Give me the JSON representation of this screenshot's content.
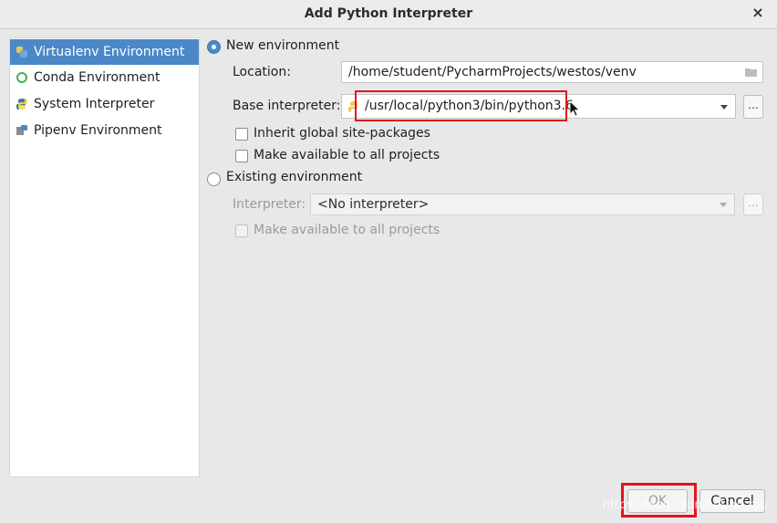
{
  "window": {
    "title": "Add Python Interpreter",
    "close_glyph": "×"
  },
  "sidebar": {
    "items": [
      {
        "label": "Virtualenv Environment",
        "icon": "virtualenv-icon",
        "selected": true
      },
      {
        "label": "Conda Environment",
        "icon": "conda-icon",
        "selected": false
      },
      {
        "label": "System Interpreter",
        "icon": "python-icon",
        "selected": false
      },
      {
        "label": "Pipenv Environment",
        "icon": "pipenv-icon",
        "selected": false
      }
    ]
  },
  "new_env": {
    "radio_label": "New environment",
    "selected": true,
    "location_label": "Location:",
    "location_value": "/home/student/PycharmProjects/westos/venv",
    "base_label": "Base interpreter:",
    "base_value": "/usr/local/python3/bin/python3.6",
    "browse_label": "...",
    "inherit_label": "Inherit global site-packages",
    "make_available_label": "Make available to all projects"
  },
  "existing_env": {
    "radio_label": "Existing environment",
    "selected": false,
    "interpreter_label": "Interpreter:",
    "interpreter_value": "<No interpreter>",
    "browse_label": "...",
    "make_available_label": "Make available to all projects"
  },
  "buttons": {
    "ok": "OK",
    "cancel": "Cancel"
  },
  "watermark": "https://blog.csdn.net/lyf_qiu",
  "colors": {
    "selection": "#4a88c7",
    "highlight_box": "#e0141e"
  }
}
